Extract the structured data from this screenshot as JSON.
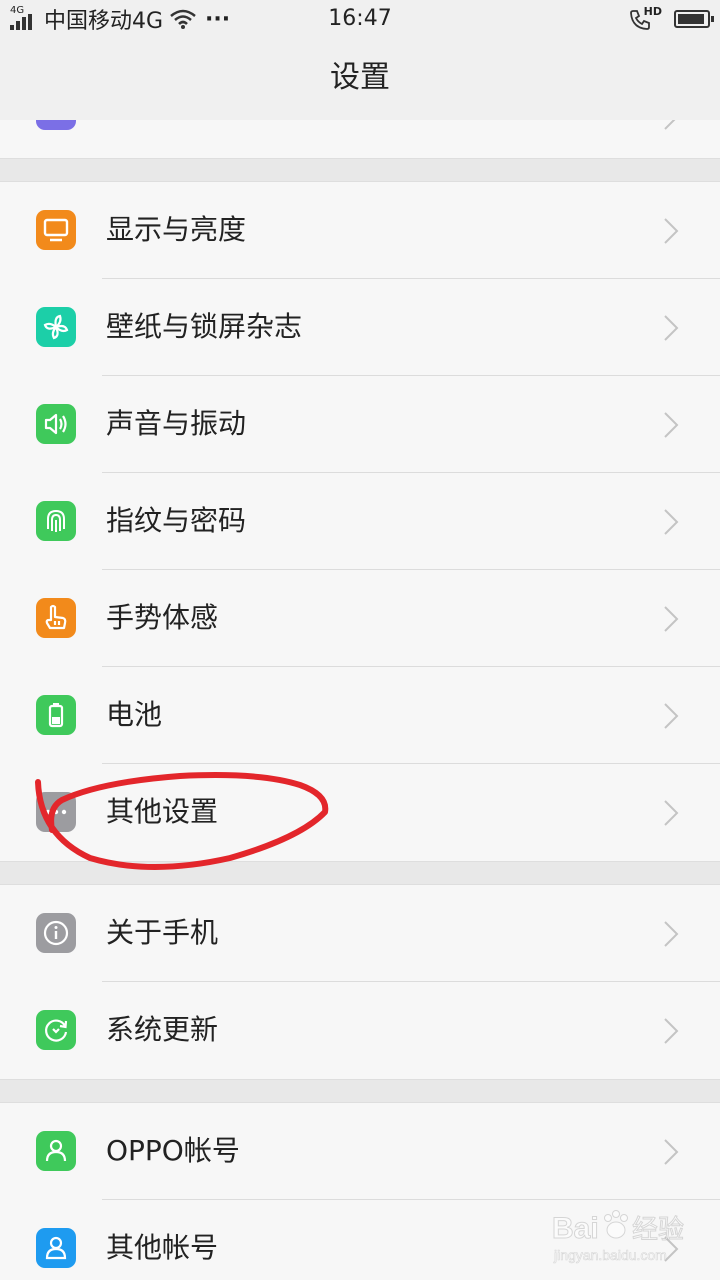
{
  "status_bar": {
    "network_label": "4G",
    "carrier": "中国移动4G",
    "more": "···",
    "time": "16:47",
    "hd": "HD"
  },
  "header": {
    "title": "设置"
  },
  "sections": [
    {
      "items": [
        {
          "label": "显示与亮度",
          "icon": "display-icon",
          "color": "#f28a1b"
        },
        {
          "label": "壁纸与锁屏杂志",
          "icon": "wallpaper-icon",
          "color": "#1ccfa8"
        },
        {
          "label": "声音与振动",
          "icon": "sound-icon",
          "color": "#3fc95b"
        },
        {
          "label": "指纹与密码",
          "icon": "fingerprint-icon",
          "color": "#3fc95b"
        },
        {
          "label": "手势体感",
          "icon": "gesture-icon",
          "color": "#f28a1b"
        },
        {
          "label": "电池",
          "icon": "battery-icon",
          "color": "#3fc95b"
        },
        {
          "label": "其他设置",
          "icon": "more-icon",
          "color": "#9c9ca0"
        }
      ]
    },
    {
      "items": [
        {
          "label": "关于手机",
          "icon": "info-icon",
          "color": "#9c9ca0"
        },
        {
          "label": "系统更新",
          "icon": "update-icon",
          "color": "#3fc95b"
        }
      ]
    },
    {
      "items": [
        {
          "label": "OPPO帐号",
          "icon": "user-icon",
          "color": "#3fc95b"
        },
        {
          "label": "其他帐号",
          "icon": "account-icon",
          "color": "#1e9bf0"
        }
      ]
    }
  ],
  "watermark": {
    "brand": "Bai",
    "brand_suffix": "经验",
    "url": "jingyan.baidu.com"
  }
}
